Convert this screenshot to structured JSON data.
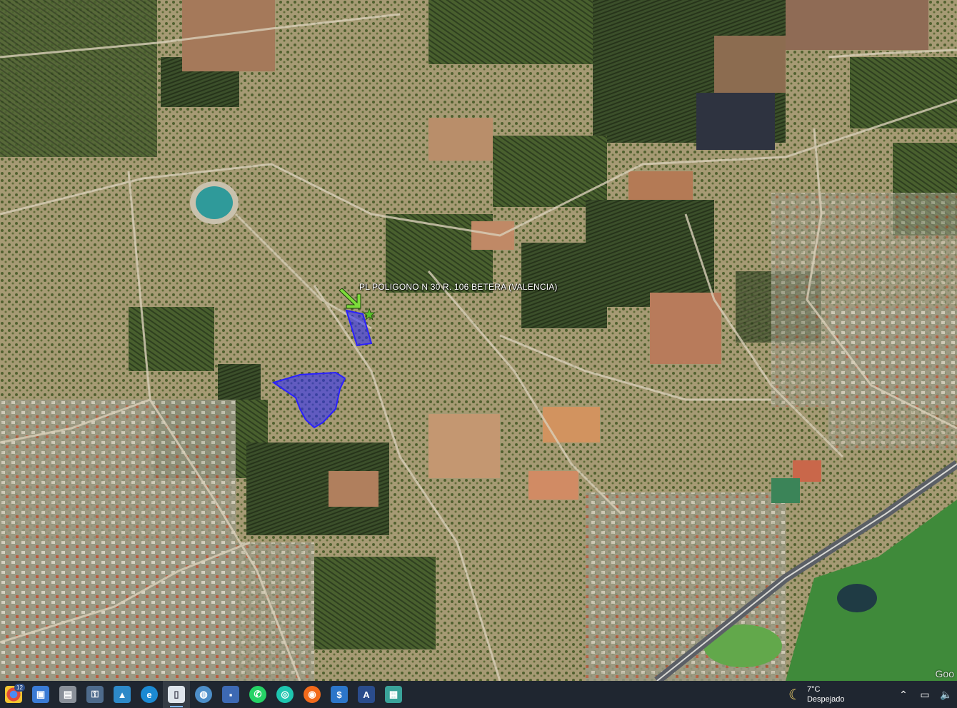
{
  "map": {
    "placemark_label": "PL POLIGONO N 30 R. 106 BETERA (VALENCIA)",
    "placemark_color": "#7ddc3a",
    "parcel_fill": "rgba(40,40,255,0.55)",
    "parcel_stroke": "#2a20ff",
    "attribution": "Goo"
  },
  "taskbar": {
    "badge_count": "12",
    "apps": [
      {
        "name": "chrome",
        "glyph": "●",
        "color": "#e2a321"
      },
      {
        "name": "photos",
        "glyph": "▣",
        "color": "#3a7bd5"
      },
      {
        "name": "print",
        "glyph": "▤",
        "color": "#8a9099"
      },
      {
        "name": "lock-file",
        "glyph": "🔒",
        "color": "#4e6b8c"
      },
      {
        "name": "gallery",
        "glyph": "▲",
        "color": "#2d89c8"
      },
      {
        "name": "edge",
        "glyph": "e",
        "color": "#1b8ad3"
      },
      {
        "name": "file",
        "glyph": "▯",
        "color": "#dfe5ec"
      },
      {
        "name": "earth",
        "glyph": "◍",
        "color": "#4d8ec9"
      },
      {
        "name": "save",
        "glyph": "▪",
        "color": "#3d69b3"
      },
      {
        "name": "whatsapp",
        "glyph": "✆",
        "color": "#25d366"
      },
      {
        "name": "edge-swirl",
        "glyph": "◎",
        "color": "#1ec6b0"
      },
      {
        "name": "firefox",
        "glyph": "◉",
        "color": "#f26a1b"
      },
      {
        "name": "dollar",
        "glyph": "$",
        "color": "#2c76c9"
      },
      {
        "name": "apex",
        "glyph": "A",
        "color": "#2a4c8c"
      },
      {
        "name": "monitor",
        "glyph": "▦",
        "color": "#3aa39a"
      }
    ]
  },
  "weather": {
    "temp": "7°C",
    "desc": "Despejado"
  }
}
